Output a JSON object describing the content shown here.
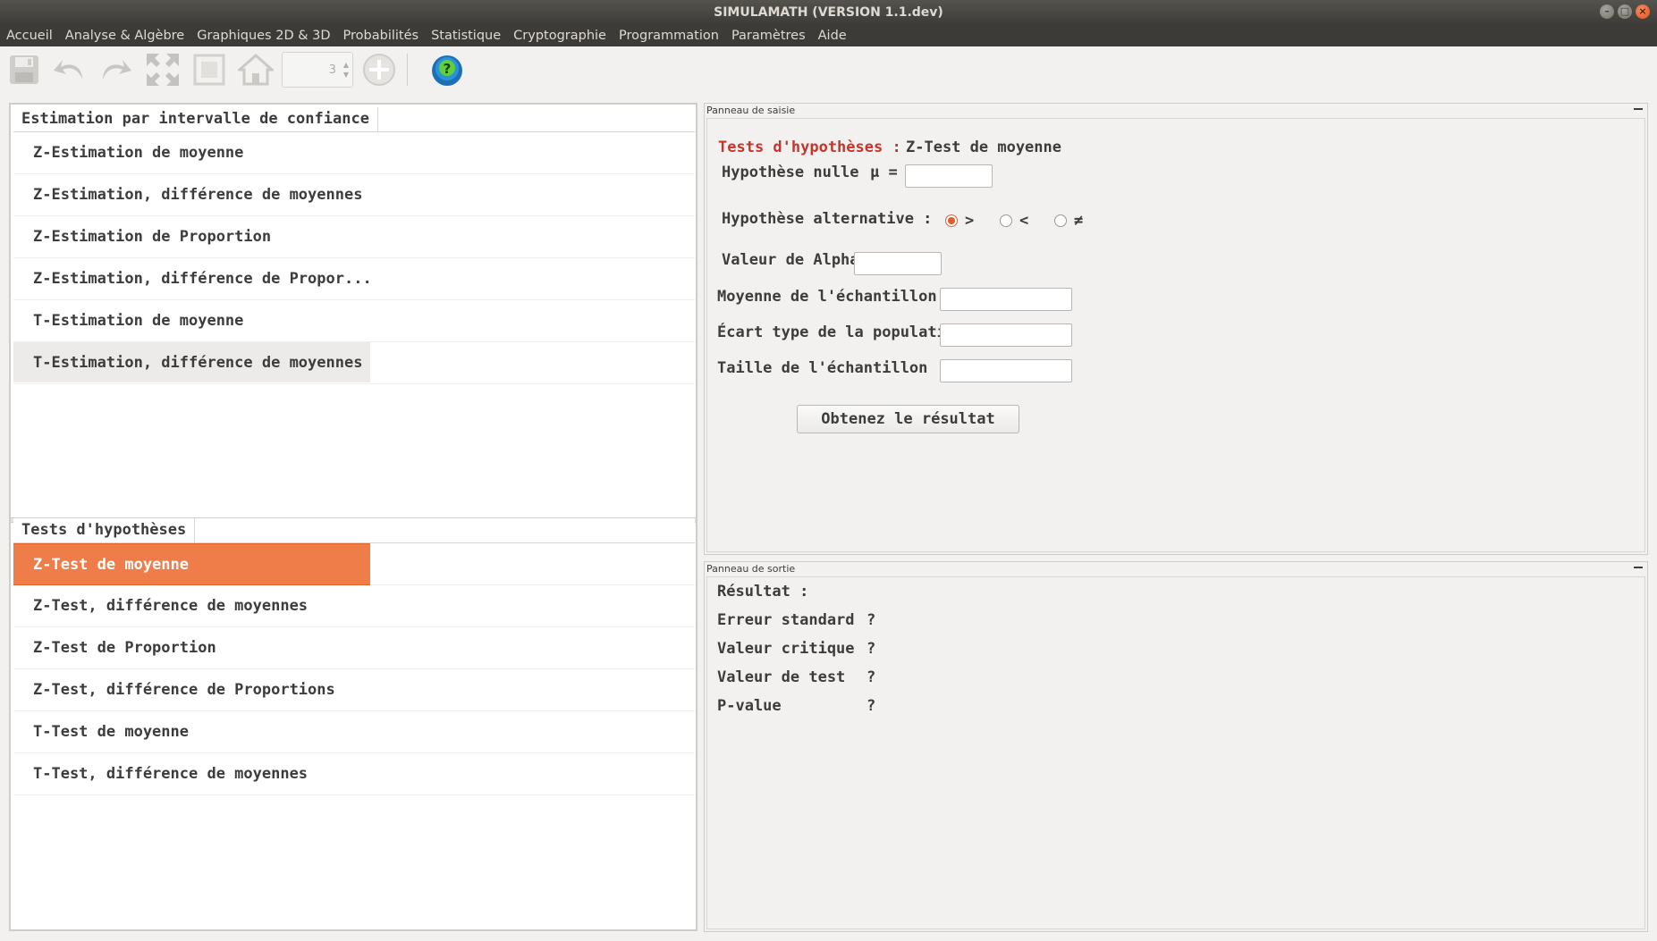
{
  "window": {
    "title": "SIMULAMATH   (VERSION 1.1.dev)",
    "buttons": {
      "minimize": "–",
      "maximize": "□",
      "close": "×"
    }
  },
  "menu": [
    "Accueil",
    "Analyse & Algèbre",
    "Graphiques 2D & 3D",
    "Probabilités",
    "Statistique",
    "Cryptographie",
    "Programmation",
    "Paramètres",
    "Aide"
  ],
  "toolbar": {
    "spinner_value": "3",
    "icons": [
      "save-icon",
      "undo-icon",
      "redo-icon",
      "expand-icon",
      "fit-icon",
      "home-icon",
      "add-icon",
      "help-icon"
    ]
  },
  "left": {
    "estimation": {
      "header": "Estimation par intervalle de confiance",
      "items": [
        "Z-Estimation de moyenne",
        "Z-Estimation, différence de moyennes",
        "Z-Estimation de Proportion",
        "Z-Estimation, différence de Propor...",
        "T-Estimation de moyenne",
        "T-Estimation, différence de moyennes"
      ]
    },
    "tests": {
      "header": "Tests d'hypothèses",
      "items": [
        "Z-Test de moyenne",
        "Z-Test, différence de moyennes",
        "Z-Test de Proportion",
        "Z-Test, différence de Proportions",
        "T-Test de moyenne",
        "T-Test, différence de moyennes"
      ]
    }
  },
  "input_panel": {
    "title": "Panneau de saisie",
    "heading_category": "Tests d'hypothèses : ",
    "heading_test": "Z-Test de moyenne",
    "null_label": "Hypothèse nulle :",
    "mu_label": "μ =",
    "alt_label": "Hypothèse alternative :",
    "alt_options": [
      ">",
      "<",
      "≠"
    ],
    "alpha_label": "Valeur de Alpha :",
    "sample_mean_label": "Moyenne de l'échantillon",
    "pop_std_label": "Écart type de la population",
    "sample_size_label": "Taille de l'échantillon",
    "mu_value": "",
    "alpha_value": "",
    "sample_mean_value": "",
    "pop_std_value": "",
    "sample_size_value": "",
    "submit": "Obtenez le résultat"
  },
  "output_panel": {
    "title": "Panneau de sortie",
    "result_label": "Résultat :",
    "rows": [
      {
        "label": "Erreur standard",
        "value": "?"
      },
      {
        "label": "Valeur critique",
        "value": "?"
      },
      {
        "label": "Valeur de test",
        "value": "?"
      },
      {
        "label": "P-value",
        "value": "?"
      }
    ]
  }
}
